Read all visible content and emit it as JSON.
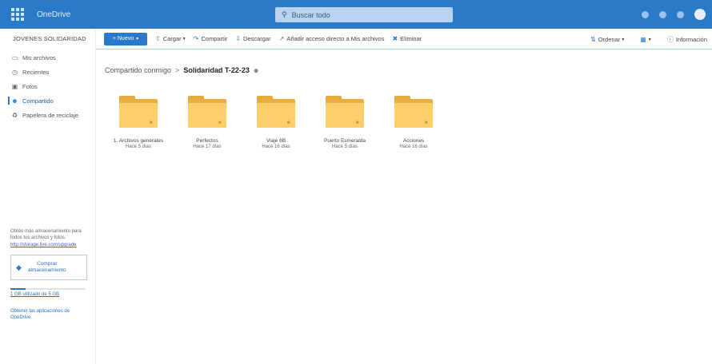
{
  "topbar": {
    "app_name": "OneDrive",
    "search_placeholder": "Buscar todo"
  },
  "sidebar": {
    "account_name": "JOVENES SOLIDARIDAD",
    "items": [
      {
        "label": "Mis archivos",
        "icon": "folder-icon",
        "active": false
      },
      {
        "label": "Recientes",
        "icon": "clock-icon",
        "active": false
      },
      {
        "label": "Fotos",
        "icon": "image-icon",
        "active": false
      },
      {
        "label": "Compartido",
        "icon": "people-icon",
        "active": true
      },
      {
        "label": "Papelera de reciclaje",
        "icon": "recycle-bin-icon",
        "active": false
      }
    ],
    "storage": {
      "message": "Obtén más almacenamiento para todos tus archivos y fotos.",
      "link": "http://storage.live.com/upgrade",
      "buy_label_line1": "Comprar",
      "buy_label_line2": "almacenamiento",
      "usage_text": "1 GB utilizado de 5 GB",
      "usage_fraction": 0.2,
      "apps_link_line1": "Obtener las aplicaciones de",
      "apps_link_line2": "OneDrive"
    }
  },
  "cmdbar": {
    "new_label": "+ Nuevo",
    "upload_label": "Cargar",
    "share_label": "Compartir",
    "download_label": "Descargar",
    "add_shortcut_label": "Añadir acceso directo a Mis archivos",
    "delete_label": "Eliminar",
    "sort_label": "Ordenar",
    "info_label": "Información"
  },
  "breadcrumb": {
    "parent": "Compartido conmigo",
    "separator": ">",
    "current": "Solidaridad T-22-23"
  },
  "folders": [
    {
      "name": "1. Archivos generales",
      "modified": "Hace 5 días"
    },
    {
      "name": "Perfectos",
      "modified": "Hace 17 días"
    },
    {
      "name": "Viaje 6B",
      "modified": "Hace 16 días"
    },
    {
      "name": "Puerto Esmeralda",
      "modified": "Hace 5 días"
    },
    {
      "name": "Acciones",
      "modified": "Hace 16 días"
    }
  ],
  "colors": {
    "accent": "#2b79c9",
    "folder": "#fccf6a"
  }
}
